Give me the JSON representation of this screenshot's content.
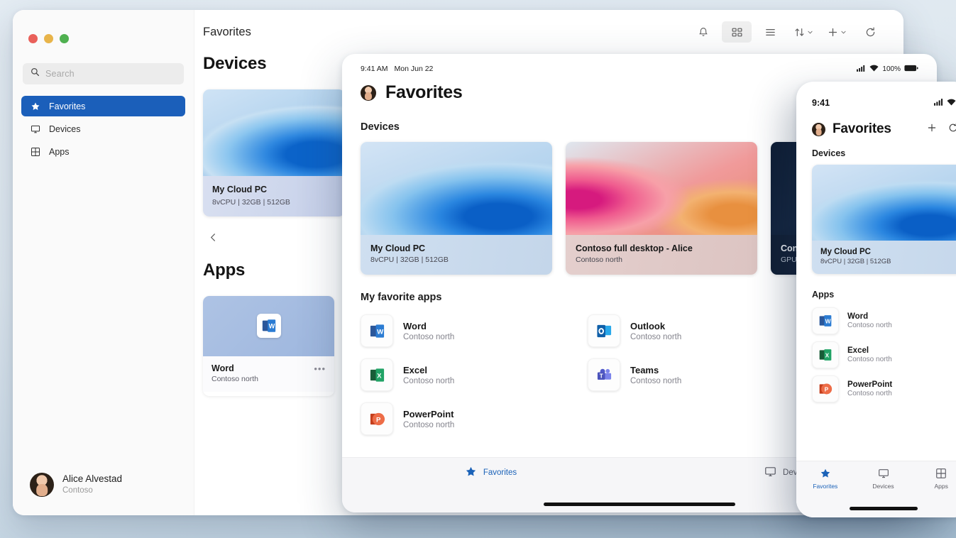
{
  "desktop": {
    "window_controls": [
      "close",
      "minimize",
      "maximize"
    ],
    "search": {
      "placeholder": "Search"
    },
    "sidebar": {
      "items": [
        {
          "label": "Favorites",
          "icon": "star-icon",
          "active": true
        },
        {
          "label": "Devices",
          "icon": "monitor-icon",
          "active": false
        },
        {
          "label": "Apps",
          "icon": "grid-icon",
          "active": false
        }
      ]
    },
    "user": {
      "name": "Alice Alvestad",
      "org": "Contoso"
    },
    "header": {
      "title": "Favorites"
    },
    "toolbar": {
      "items": [
        {
          "name": "notifications-bell-icon",
          "label": ""
        },
        {
          "name": "grid-view-icon",
          "label": ""
        },
        {
          "name": "list-view-icon",
          "label": ""
        },
        {
          "name": "sort-icon",
          "label": ""
        },
        {
          "name": "add-icon",
          "label": ""
        },
        {
          "name": "refresh-icon",
          "label": ""
        }
      ]
    },
    "devices_section": {
      "title": "Devices"
    },
    "apps_section": {
      "title": "Apps"
    },
    "device_cards": [
      {
        "name": "My Cloud PC",
        "spec": "8vCPU | 32GB | 512GB"
      }
    ],
    "app_cards": [
      {
        "name": "Word",
        "sub": "Contoso north",
        "icon": "word-icon",
        "menu": "•••"
      }
    ]
  },
  "tablet": {
    "status": {
      "time": "9:41 AM",
      "date": "Mon Jun 22",
      "battery": "100%"
    },
    "header": {
      "title": "Favorites"
    },
    "devices_section": {
      "title": "Devices"
    },
    "device_cards": [
      {
        "name": "My Cloud PC",
        "sub": "8vCPU | 32GB | 512GB",
        "theme": "blue"
      },
      {
        "name": "Contoso full desktop - Alice",
        "sub": "Contoso north",
        "theme": "pink"
      },
      {
        "name": "Contoso",
        "sub": "GPU Standa",
        "theme": "dark"
      }
    ],
    "apps_section": {
      "title": "My favorite apps"
    },
    "apps": [
      {
        "name": "Word",
        "sub": "Contoso north",
        "icon": "word-icon"
      },
      {
        "name": "Outlook",
        "sub": "Contoso north",
        "icon": "outlook-icon"
      },
      {
        "name": "Excel",
        "sub": "Contoso north",
        "icon": "excel-icon"
      },
      {
        "name": "Teams",
        "sub": "Contoso north",
        "icon": "teams-icon"
      },
      {
        "name": "PowerPoint",
        "sub": "Contoso north",
        "icon": "powerpoint-icon"
      }
    ],
    "tabbar": [
      {
        "label": "Favorites",
        "icon": "star-icon",
        "active": true
      },
      {
        "label": "Devices",
        "icon": "monitor-icon",
        "active": false
      }
    ]
  },
  "phone": {
    "status": {
      "time": "9:41"
    },
    "header": {
      "title": "Favorites"
    },
    "actions": [
      {
        "name": "add-icon",
        "label": "+"
      },
      {
        "name": "refresh-icon",
        "label": ""
      }
    ],
    "devices_section": {
      "title": "Devices"
    },
    "device_cards": [
      {
        "name": "My Cloud PC",
        "sub": "8vCPU | 32GB | 512GB"
      }
    ],
    "apps_section": {
      "title": "Apps"
    },
    "apps": [
      {
        "name": "Word",
        "sub": "Contoso north",
        "icon": "word-icon"
      },
      {
        "name": "Excel",
        "sub": "Contoso north",
        "icon": "excel-icon"
      },
      {
        "name": "PowerPoint",
        "sub": "Contoso north",
        "icon": "powerpoint-icon"
      }
    ],
    "tabbar": [
      {
        "label": "Favorites",
        "icon": "star-icon",
        "active": true
      },
      {
        "label": "Devices",
        "icon": "monitor-icon",
        "active": false
      },
      {
        "label": "Apps",
        "icon": "grid-icon",
        "active": false
      }
    ]
  },
  "colors": {
    "accent": "#1b5fba",
    "tab_accent": "#1b62b8",
    "sidebar_bg": "#fafafa",
    "page_bg": "#cbdae6"
  }
}
